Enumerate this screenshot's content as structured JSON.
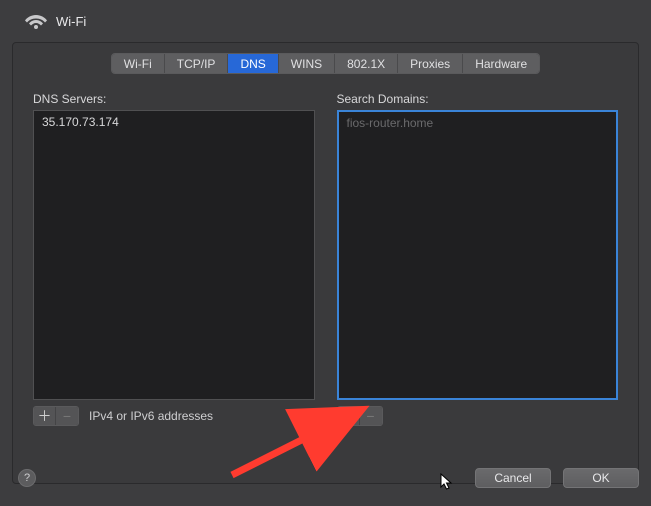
{
  "title": "Wi-Fi",
  "tabs": {
    "wifi": "Wi-Fi",
    "tcpip": "TCP/IP",
    "dns": "DNS",
    "wins": "WINS",
    "8021x": "802.1X",
    "proxies": "Proxies",
    "hardware": "Hardware"
  },
  "active_tab": "dns",
  "dns": {
    "label": "DNS Servers:",
    "items": [
      "35.170.73.174"
    ],
    "helper": "IPv4 or IPv6 addresses"
  },
  "search": {
    "label": "Search Domains:",
    "placeholder": "fios-router.home"
  },
  "glyphs": {
    "plus": "＋",
    "minus": "−",
    "help": "?"
  },
  "footer": {
    "cancel": "Cancel",
    "ok": "OK"
  }
}
